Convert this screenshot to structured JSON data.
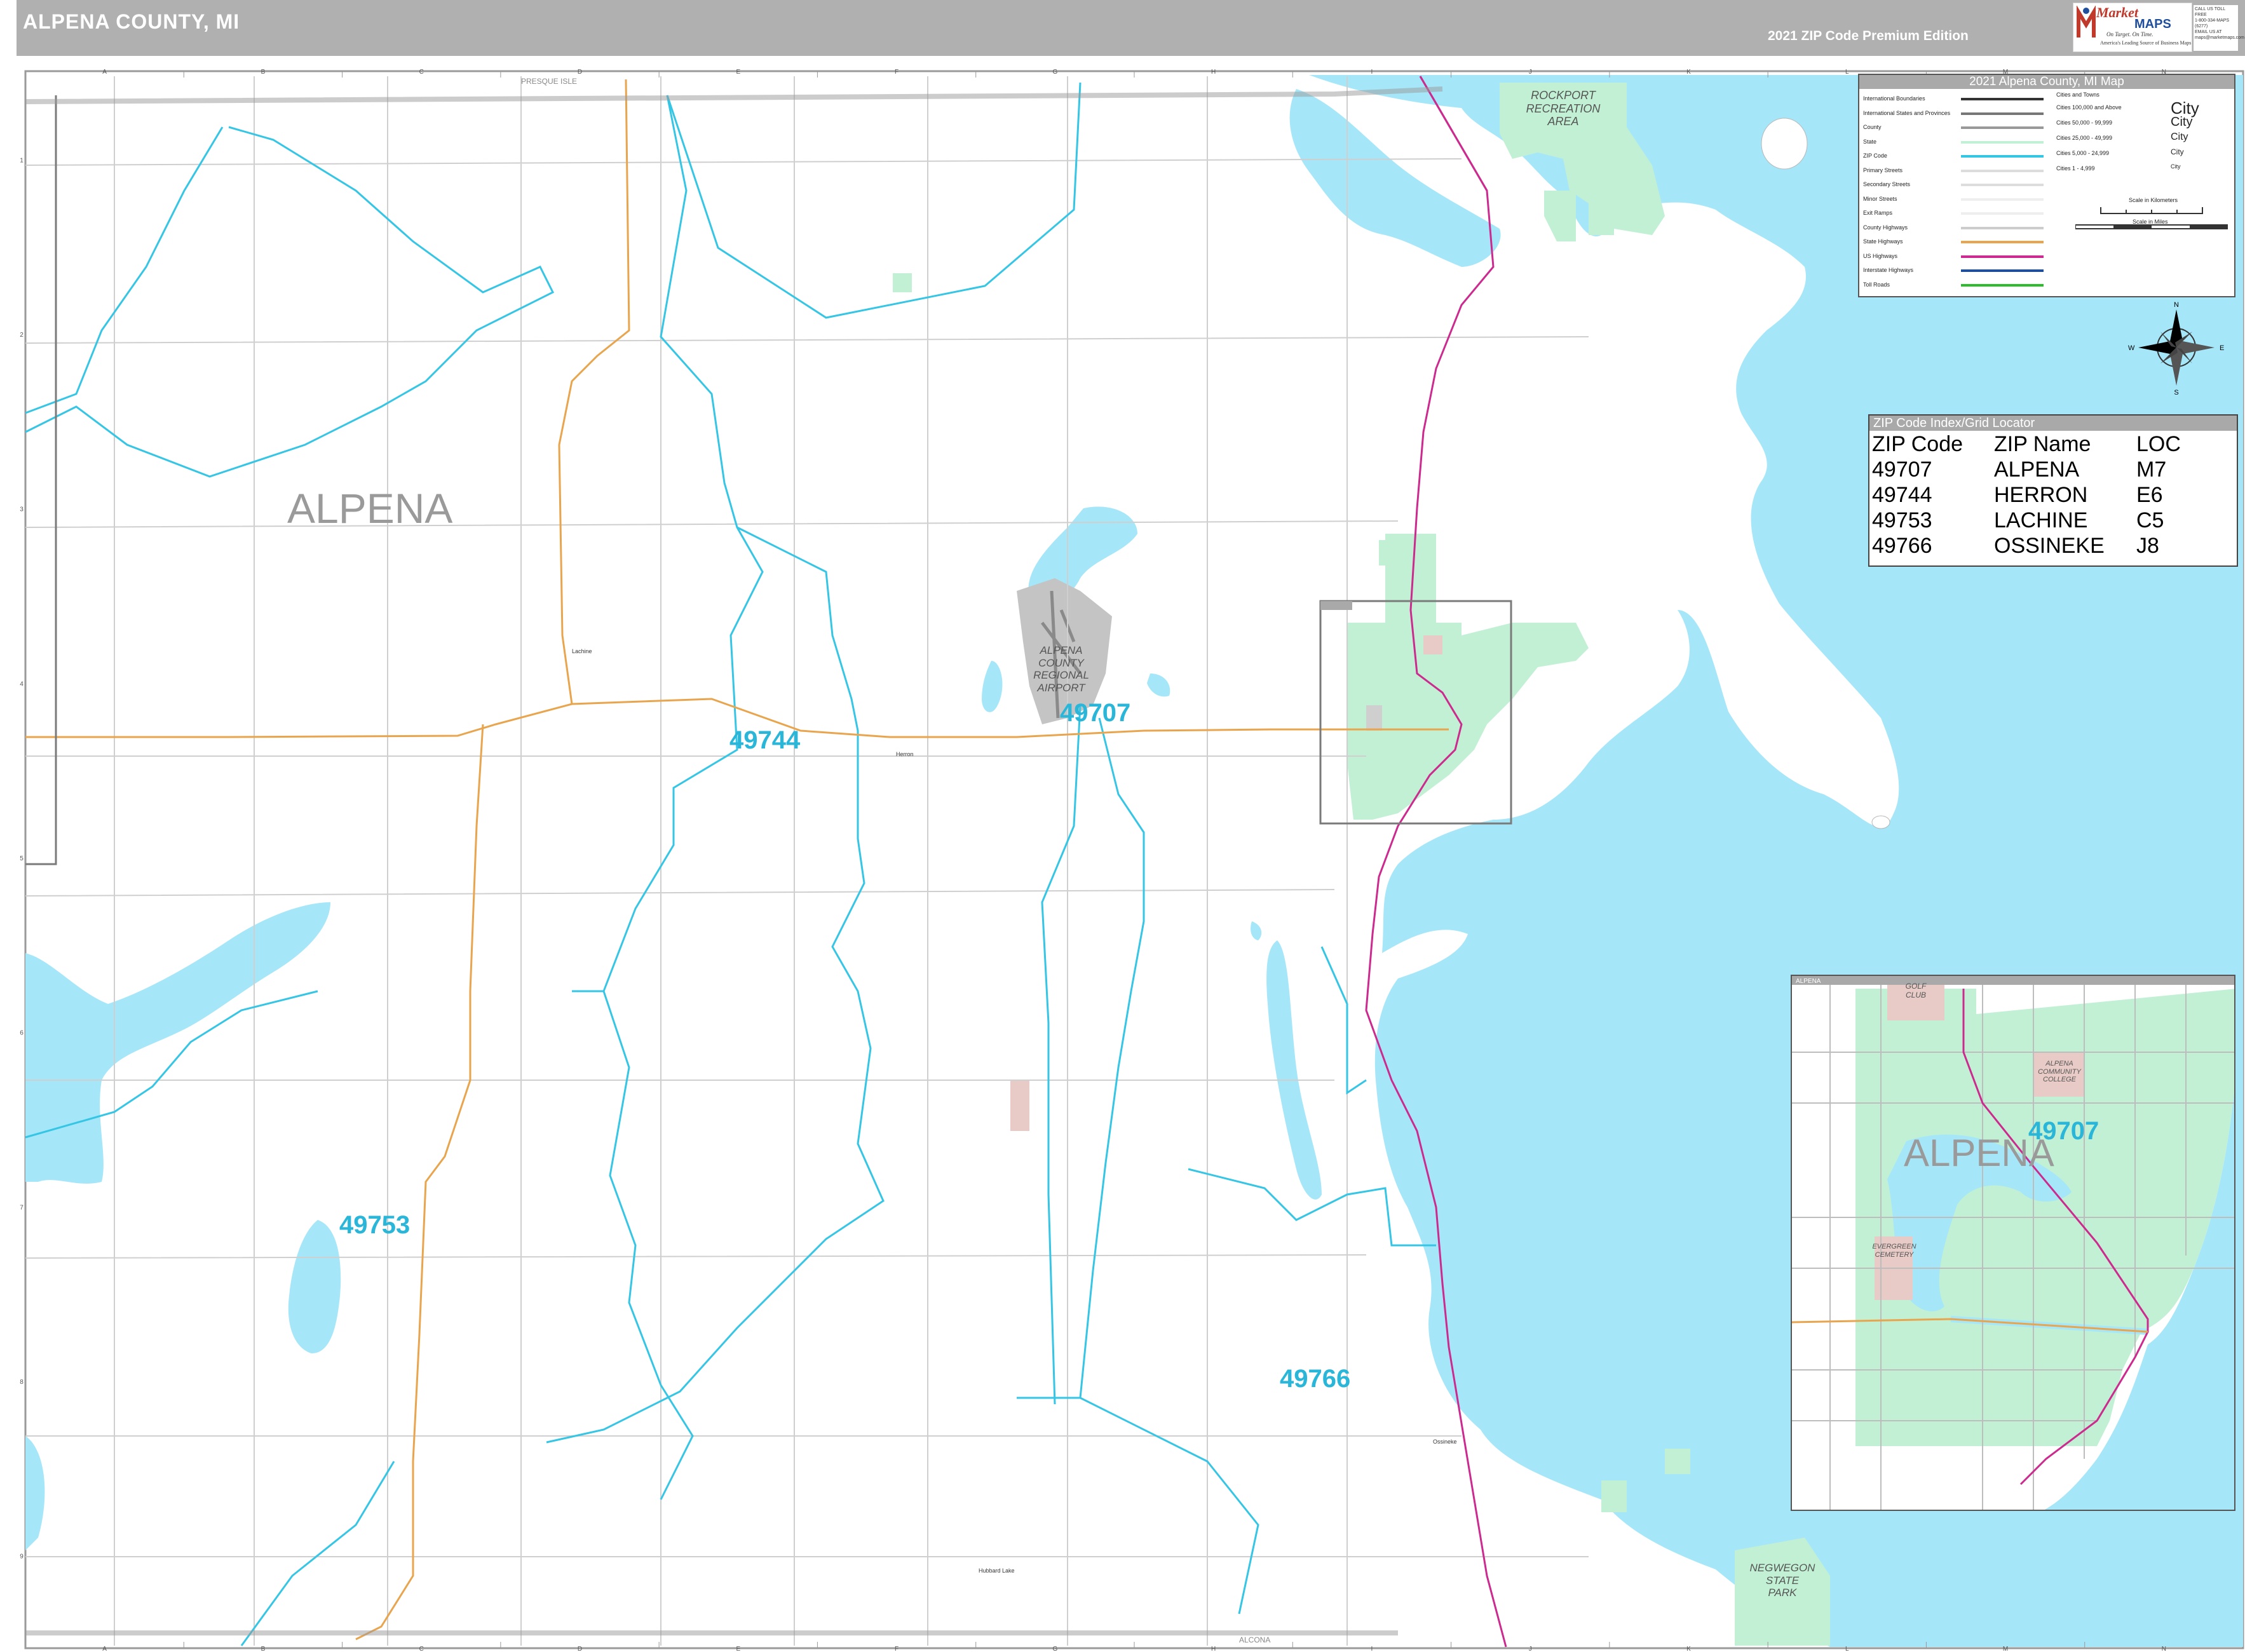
{
  "header": {
    "title": "ALPENA COUNTY, MI",
    "edition": "2021 ZIP Code Premium Edition"
  },
  "logo": {
    "word1": "Market",
    "word2": "MAPS",
    "tagline": "On Target.  On Time.",
    "sub": "America's Leading Source of Business Maps",
    "contact": [
      "CALL US TOLL FREE",
      "1-800-334-MAPS (6277)",
      "EMAIL US AT",
      "maps@marketmaps.com"
    ]
  },
  "legend": {
    "title": "2021 Alpena County, MI Map",
    "line_items": [
      "International Boundaries",
      "International States and Provinces",
      "County",
      "State",
      "ZIP Code",
      "Primary Streets",
      "Secondary Streets",
      "Minor Streets",
      "Exit Ramps",
      "County Highways",
      "State Highways",
      "US Highways",
      "Interstate Highways",
      "Toll Roads"
    ],
    "cities_header": "Cities and Towns",
    "city_items": [
      {
        "label": "Cities 100,000 and Above",
        "sample": "City"
      },
      {
        "label": "Cities 50,000 - 99,999",
        "sample": "City"
      },
      {
        "label": "Cities 25,000 - 49,999",
        "sample": "City"
      },
      {
        "label": "Cities 5,000 - 24,999",
        "sample": "City"
      },
      {
        "label": "Cities 1 - 4,999",
        "sample": "City"
      }
    ],
    "scale_km": "Scale in Kilometers",
    "scale_mi": "Scale in Miles"
  },
  "compass": {
    "n": "N",
    "s": "S",
    "e": "E",
    "w": "W"
  },
  "zip_index": {
    "title": "ZIP Code Index/Grid Locator",
    "headers": [
      "ZIP Code",
      "ZIP Name",
      "LOC"
    ],
    "rows": [
      [
        "49707",
        "ALPENA",
        "M7"
      ],
      [
        "49744",
        "HERRON",
        "E6"
      ],
      [
        "49753",
        "LACHINE",
        "C5"
      ],
      [
        "49766",
        "OSSINEKE",
        "J8"
      ]
    ]
  },
  "map_labels": {
    "county_name": "ALPENA",
    "zips": [
      "49744",
      "49707",
      "49753",
      "49766"
    ],
    "areas": {
      "rockport": "ROCKPORT\nRECREATION\nAREA",
      "airport": "ALPENA\nCOUNTY\nREGIONAL\nAIRPORT",
      "negwegon": "NEGWEGON\nSTATE\nPARK"
    },
    "border_north": "PRESQUE ISLE",
    "border_south": "ALCONA",
    "grid_cols": [
      "A",
      "B",
      "C",
      "D",
      "E",
      "F",
      "G",
      "H",
      "I",
      "J",
      "K",
      "L",
      "M",
      "N"
    ],
    "grid_rows": [
      "1",
      "2",
      "3",
      "4",
      "5",
      "6",
      "7",
      "8",
      "9"
    ],
    "towns": [
      "Lachine",
      "Herron",
      "Ossineke",
      "Hubbard Lake",
      "Alpena"
    ]
  },
  "inset": {
    "title": "ALPENA",
    "city": "ALPENA",
    "zip": "49707",
    "areas": [
      "GOLF\nCLUB",
      "ALPENA\nCOMMUNITY\nCOLLEGE",
      "EVERGREEN\nCEMETERY"
    ]
  },
  "colors": {
    "water": "#a6e6f9",
    "park": "#c2f0d4",
    "zip_boundary": "#35c5e5",
    "us_highway": "#cc2a8f",
    "state_highway": "#e8a54e",
    "zip_label": "#29b6d8",
    "header": "#b0b0b0"
  }
}
